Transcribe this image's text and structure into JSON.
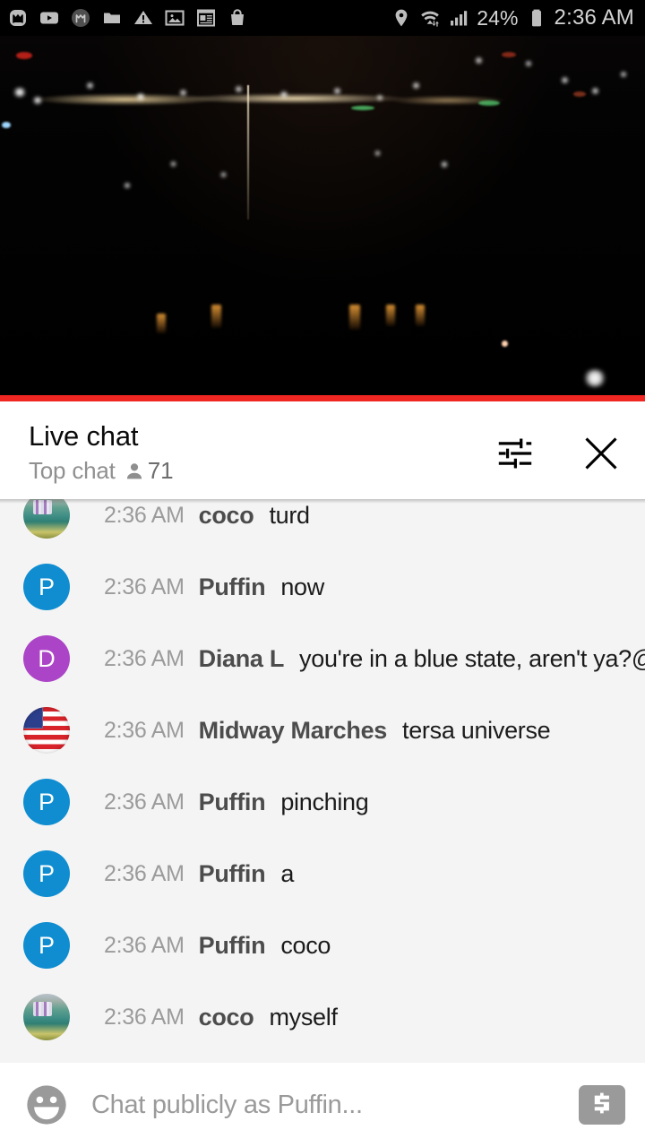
{
  "statusbar": {
    "left_icons": [
      "monzo-app-icon",
      "youtube-icon",
      "monzo-alt-icon",
      "folder-icon",
      "warning-triangle-icon",
      "image-icon",
      "news-icon",
      "shopping-bag-icon"
    ],
    "location_icon": "location-pin-icon",
    "wifi_icon": "wifi-icon",
    "signal_icon": "cell-signal-icon",
    "battery_percent": "24%",
    "battery_icon": "battery-icon",
    "time": "2:36 AM"
  },
  "video": {
    "description": "night cityscape live stream",
    "progress_color": "#ef2622",
    "progress_percent": 100
  },
  "chat_header": {
    "title": "Live chat",
    "mode": "Top chat",
    "viewer_icon": "person-icon",
    "viewer_count": "71",
    "settings_icon": "tune-sliders-icon",
    "close_icon": "close-x-icon"
  },
  "messages": [
    {
      "time": "2:36 AM",
      "author": "coco",
      "text": "turd",
      "avatar_type": "photo-coco",
      "avatar_letter": "",
      "avatar_color": ""
    },
    {
      "time": "2:36 AM",
      "author": "Puffin",
      "text": "now",
      "avatar_type": "letter",
      "avatar_letter": "P",
      "avatar_color": "#0f8dd0"
    },
    {
      "time": "2:36 AM",
      "author": "Diana L",
      "text": "you're in a blue state, aren't ya?@cee",
      "avatar_type": "letter",
      "avatar_letter": "D",
      "avatar_color": "#ab44c6"
    },
    {
      "time": "2:36 AM",
      "author": "Midway Marches",
      "text": "tersa universe",
      "avatar_type": "flag",
      "avatar_letter": "",
      "avatar_color": ""
    },
    {
      "time": "2:36 AM",
      "author": "Puffin",
      "text": "pinching",
      "avatar_type": "letter",
      "avatar_letter": "P",
      "avatar_color": "#0f8dd0"
    },
    {
      "time": "2:36 AM",
      "author": "Puffin",
      "text": "a",
      "avatar_type": "letter",
      "avatar_letter": "P",
      "avatar_color": "#0f8dd0"
    },
    {
      "time": "2:36 AM",
      "author": "Puffin",
      "text": "coco",
      "avatar_type": "letter",
      "avatar_letter": "P",
      "avatar_color": "#0f8dd0"
    },
    {
      "time": "2:36 AM",
      "author": "coco",
      "text": "myself",
      "avatar_type": "photo-coco",
      "avatar_letter": "",
      "avatar_color": ""
    }
  ],
  "input_bar": {
    "emoji_icon": "emoji-smiley-icon",
    "placeholder": "Chat publicly as Puffin...",
    "value": "",
    "superchat_icon": "dollar-superchat-icon"
  }
}
